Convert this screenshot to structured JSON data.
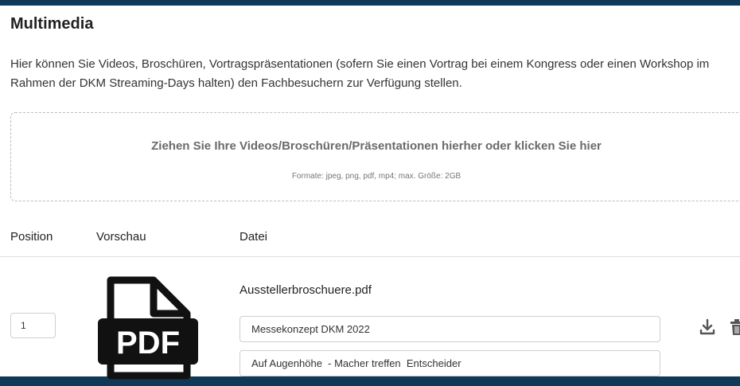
{
  "section": {
    "title": "Multimedia",
    "intro": "Hier können Sie Videos, Broschüren, Vortragspräsentationen (sofern Sie einen Vortrag bei einem Kongress oder einen Workshop im Rahmen der DKM Streaming-Days halten) den Fachbesuchern zur Verfügung stellen."
  },
  "dropzone": {
    "title": "Ziehen Sie Ihre Videos/Broschüren/Präsentationen hierher oder klicken Sie hier",
    "formats": "Formate: jpeg, png, pdf, mp4; max. Größe: 2GB"
  },
  "table": {
    "headers": {
      "position": "Position",
      "preview": "Vorschau",
      "file": "Datei"
    },
    "rows": [
      {
        "position": "1",
        "preview_icon": "pdf-file-icon",
        "preview_label": "PDF",
        "filename": "Ausstellerbroschuere.pdf",
        "title_value": "Messekonzept DKM 2022",
        "description_value": "Auf Augenhöhe  - Macher treffen  Entscheider",
        "actions": [
          "download-icon",
          "trash-icon"
        ]
      }
    ]
  },
  "colors": {
    "background_frame": "#0f3a57",
    "panel": "#ffffff",
    "icon_dark": "#555555"
  }
}
